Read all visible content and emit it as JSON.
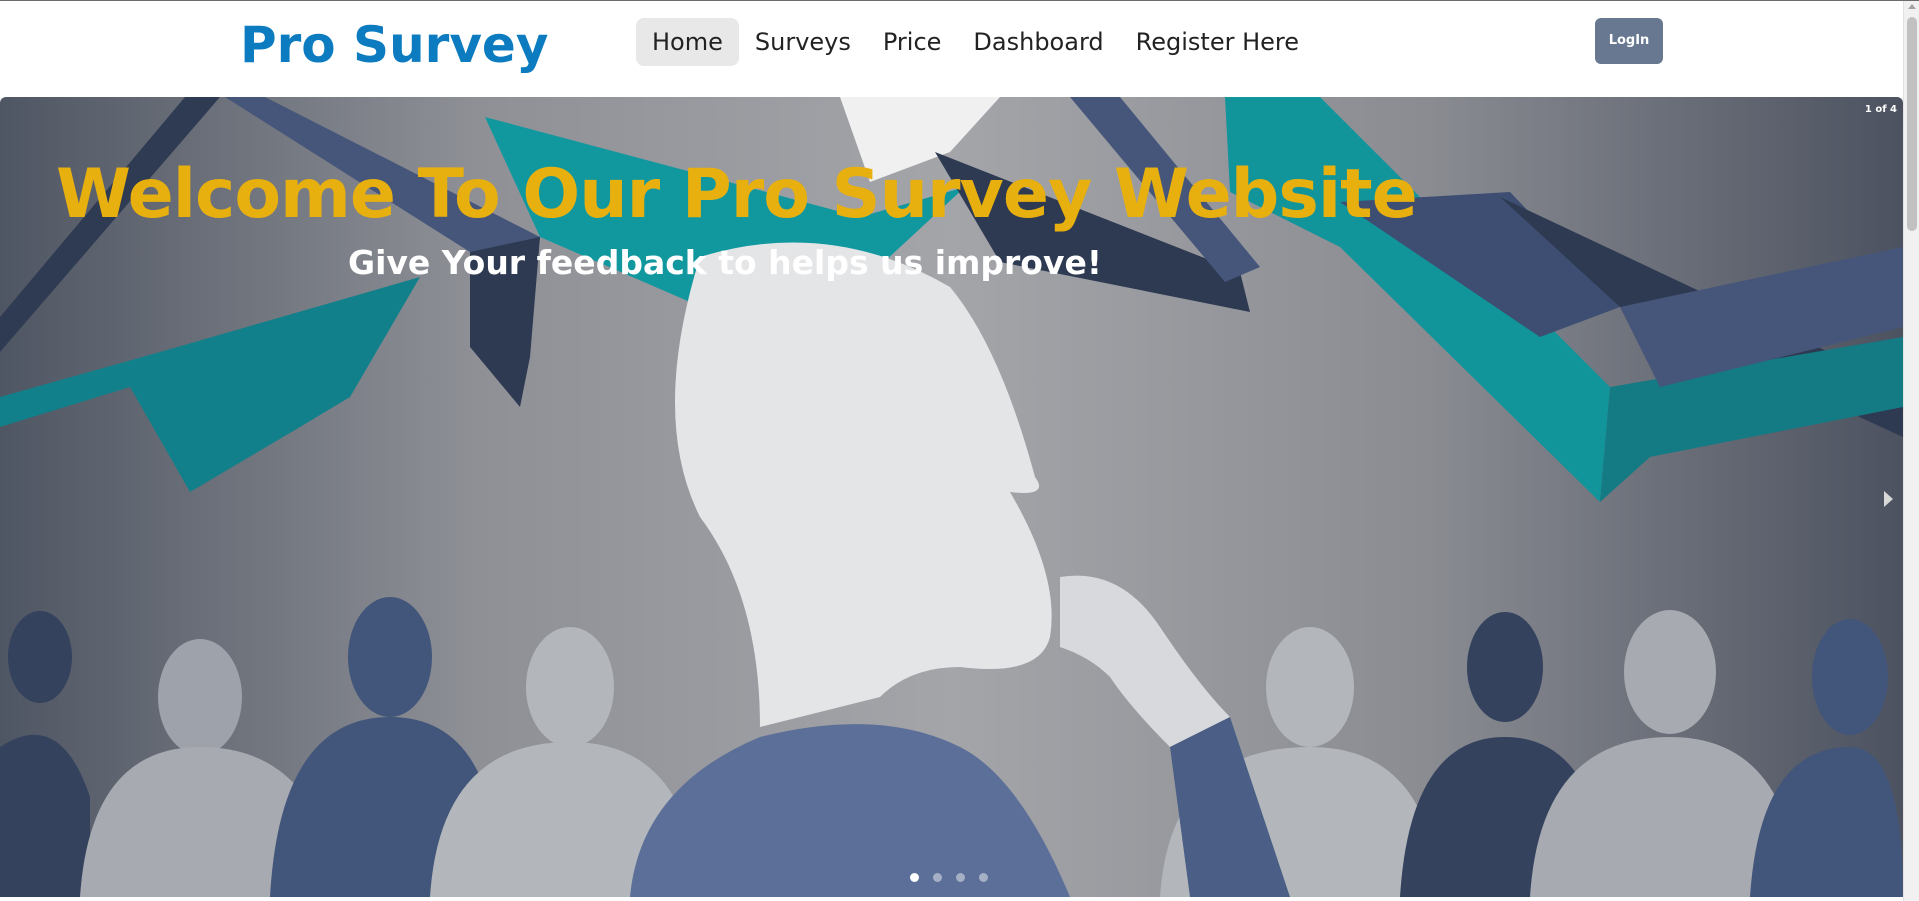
{
  "brand": {
    "name": "Pro Survey"
  },
  "nav": {
    "items": [
      {
        "label": "Home",
        "active": true
      },
      {
        "label": "Surveys"
      },
      {
        "label": "Price"
      },
      {
        "label": "Dashboard"
      },
      {
        "label": "Register Here"
      }
    ],
    "login_label": "LogIn"
  },
  "hero": {
    "counter": "1 of 4",
    "title": "Welcome To Our Pro Survey Website",
    "subtitle": "Give Your feedback to helps us improve!",
    "slides_total": 4,
    "active_slide": 1
  },
  "colors": {
    "brand": "#0c7bc0",
    "title": "#e8b00f",
    "login_bg": "#677890",
    "teal": "#12949b",
    "navy": "#2f3b52"
  }
}
